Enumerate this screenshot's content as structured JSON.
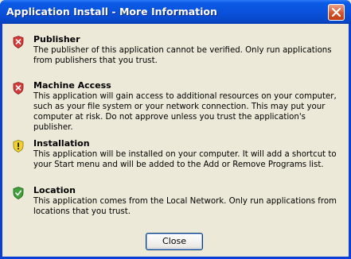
{
  "window": {
    "title": "Application Install - More Information"
  },
  "sections": [
    {
      "icon": "shield-error-icon",
      "heading": "Publisher",
      "text": "The publisher of this application cannot be verified. Only run applications from publishers that you trust."
    },
    {
      "icon": "shield-error-icon",
      "heading": "Machine Access",
      "text": "This application will gain access to additional resources on your computer, such as your file system or your network connection. This may put your computer at risk. Do not approve unless you trust the application's publisher."
    },
    {
      "icon": "shield-warning-icon",
      "heading": "Installation",
      "text": "This application will be installed on your computer. It will add a shortcut to your Start menu and will be added to the Add or Remove Programs list."
    },
    {
      "icon": "shield-ok-icon",
      "heading": "Location",
      "text": "This application comes from the Local Network. Only run applications from locations that you trust."
    }
  ],
  "buttons": {
    "close_label": "Close"
  },
  "colors": {
    "error": "#D43C3C",
    "warning": "#F2D232",
    "ok": "#3EA13A",
    "titlebar": "#0A50DA"
  }
}
